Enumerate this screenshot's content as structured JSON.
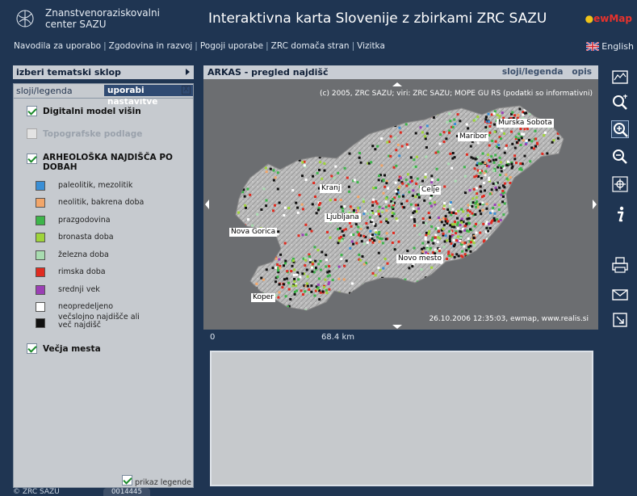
{
  "header": {
    "org_line1": "Znanstvenoraziskovalni",
    "org_line2": "center SAZU",
    "title": "Interaktivna karta Slovenije z zbirkami ZRC SAZU",
    "brand": "ewMap"
  },
  "nav": [
    "Navodila za uporabo",
    "Zgodovina in razvoj",
    "Pogoji uporabe",
    "ZRC domača stran",
    "Vizitka"
  ],
  "language": "English",
  "left_panel": {
    "heading": "izberi tematski sklop",
    "tab_legend": "sloji/legenda",
    "tab_settings": "uporabi nastavitve",
    "close": "X",
    "layers": [
      {
        "label": "Digitalni model višin",
        "checked": true,
        "disabled": false
      },
      {
        "label": "Topografske podlage",
        "checked": false,
        "disabled": true
      },
      {
        "label": "ARHEOLOŠKA NAJDIŠČA PO DOBAH",
        "checked": true,
        "disabled": false
      }
    ],
    "periods": [
      {
        "label": "paleolitik, mezolitik",
        "color": "#3a8fd6"
      },
      {
        "label": "neolitik, bakrena doba",
        "color": "#f2a66a"
      },
      {
        "label": "prazgodovina",
        "color": "#3db54a"
      },
      {
        "label": "bronasta doba",
        "color": "#9fd43a"
      },
      {
        "label": "železna doba",
        "color": "#a8dcb0"
      },
      {
        "label": "rimska doba",
        "color": "#e02b20"
      },
      {
        "label": "srednji vek",
        "color": "#9b3fb5"
      },
      {
        "label": "neopredeljeno",
        "color": "#ffffff"
      },
      {
        "label": "večslojno najdišče ali več najdišč",
        "color": "#111111"
      }
    ],
    "cities_layer": {
      "label": "Večja mesta",
      "checked": true
    },
    "show_legend": {
      "label": "prikaz legende",
      "checked": true
    }
  },
  "map": {
    "title": "ARKAS - pregled najdišč",
    "tab_layers": "sloji/legenda",
    "tab_desc": "opis",
    "copyright": "(c) 2005, ZRC SAZU; viri: ZRC SAZU; MOPE GU RS (podatki so informativni)",
    "stamp": "26.10.2006 12:35:03, ewmap, www.realis.si",
    "cities": [
      "Murska Sobota",
      "Maribor",
      "Kranj",
      "Celje",
      "Ljubljana",
      "Nova Gorica",
      "Novo mesto",
      "Koper"
    ],
    "scale_zero": "0",
    "scale_km": "68.4 km"
  },
  "toolbar": [
    "map-overview-icon",
    "zoom-reset-icon",
    "zoom-in-icon",
    "zoom-out-icon",
    "pan-icon",
    "info-icon",
    "print-icon",
    "mail-icon",
    "export-icon"
  ],
  "footer": {
    "copyright": "© ZRC SAZU",
    "counter": "0014445"
  }
}
